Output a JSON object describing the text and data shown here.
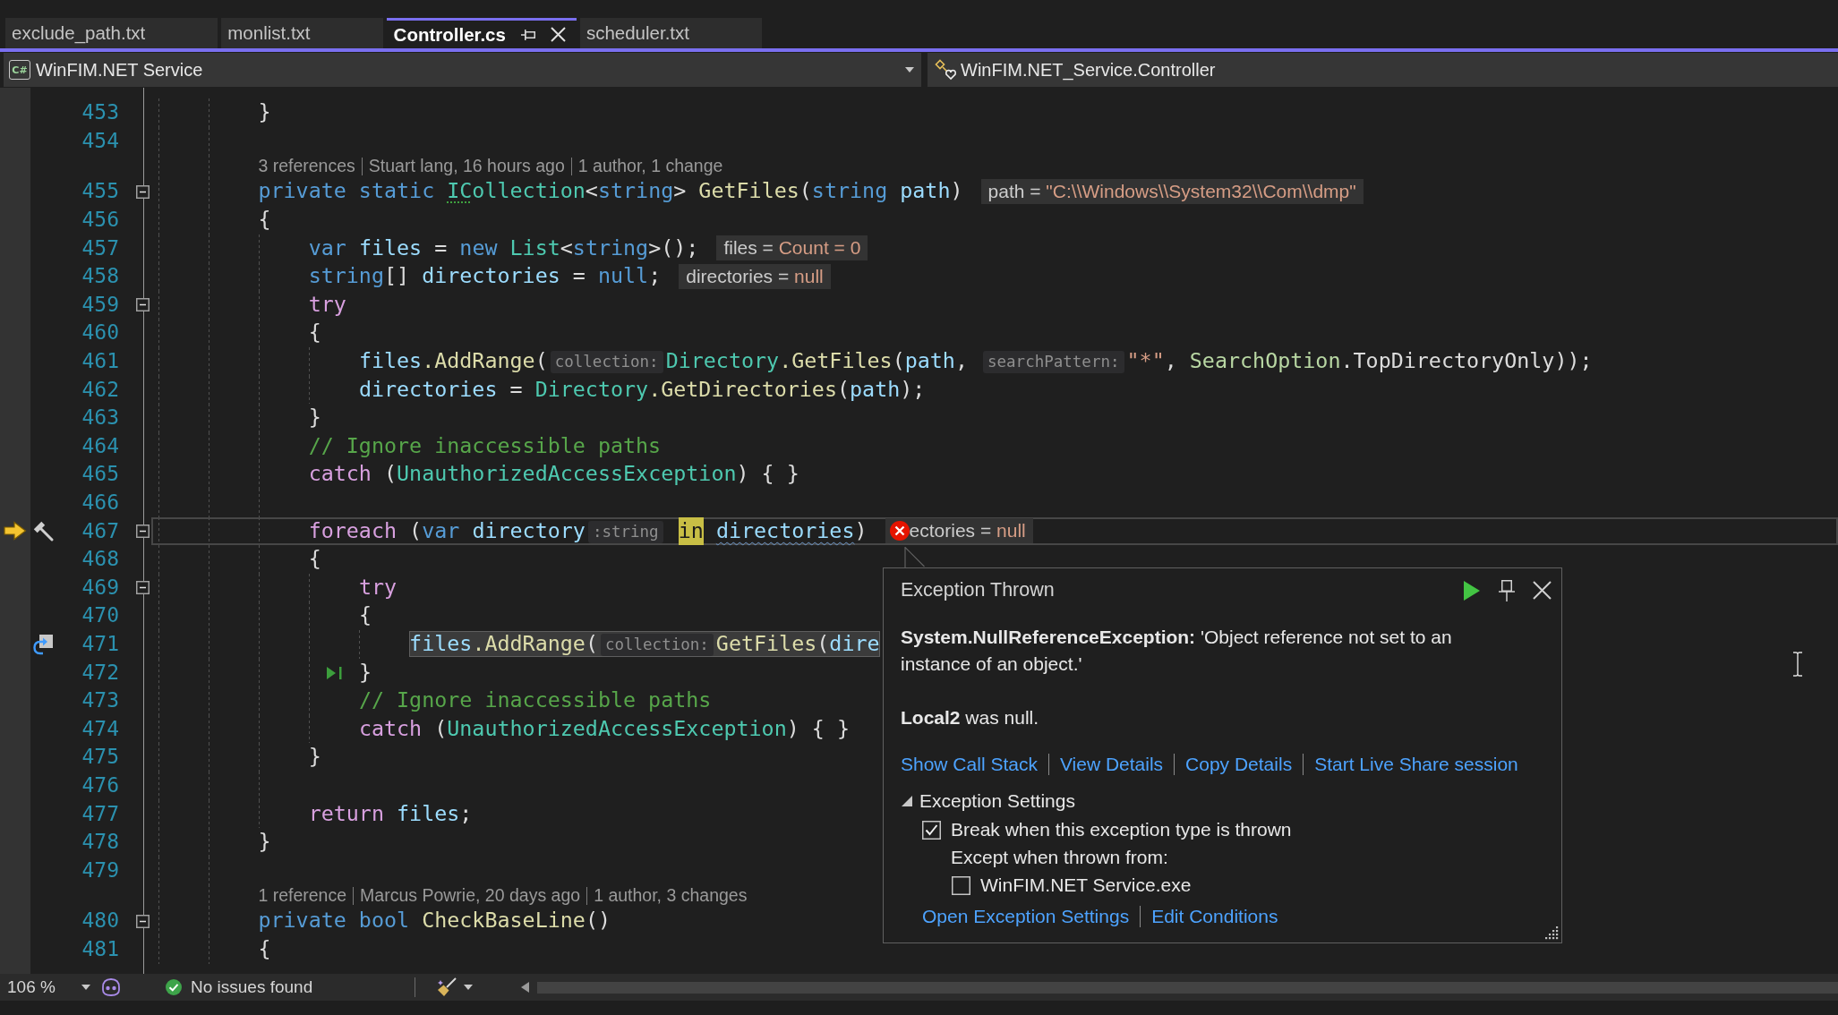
{
  "tabs": [
    {
      "label": "exclude_path.txt",
      "selected": false
    },
    {
      "label": "monlist.txt",
      "selected": false
    },
    {
      "label": "Controller.cs",
      "selected": true
    },
    {
      "label": "scheduler.txt",
      "selected": false
    }
  ],
  "navigation_bar": {
    "project": {
      "badge": "C#",
      "label": "WinFIM.NET Service"
    },
    "type": {
      "label": "WinFIM.NET_Service.Controller"
    }
  },
  "editor": {
    "lines": [
      {
        "kind": "code",
        "number": "453",
        "tokens": [
          {
            "kind": "plain",
            "text": "        }"
          }
        ]
      },
      {
        "kind": "code",
        "number": "454"
      },
      {
        "kind": "codelens",
        "items": [
          "3 references",
          "Stuart lang, 16 hours ago",
          "1 author, 1 change"
        ]
      },
      {
        "kind": "code",
        "number": "455",
        "expanded": true,
        "tokens": [
          {
            "kind": "keyword",
            "text": "        private static "
          },
          {
            "kind": "type",
            "text": "IC",
            "suggestion": true
          },
          {
            "kind": "type",
            "text": "ollection"
          },
          {
            "kind": "plain",
            "text": "<"
          },
          {
            "kind": "keyword",
            "text": "string"
          },
          {
            "kind": "plain",
            "text": "> "
          },
          {
            "kind": "method",
            "text": "GetFiles"
          },
          {
            "kind": "plain",
            "text": "("
          },
          {
            "kind": "keyword",
            "text": "string "
          },
          {
            "kind": "local",
            "text": "path"
          },
          {
            "kind": "plain",
            "text": ")"
          }
        ],
        "datatip": {
          "label": "path =",
          "value": "\"C:\\\\Windows\\\\System32\\\\Com\\\\dmp\""
        }
      },
      {
        "kind": "code",
        "number": "456",
        "tokens": [
          {
            "kind": "plain",
            "text": "        {"
          }
        ]
      },
      {
        "kind": "code",
        "number": "457",
        "tokens": [
          {
            "kind": "keyword",
            "text": "            var "
          },
          {
            "kind": "local",
            "text": "files"
          },
          {
            "kind": "plain",
            "text": " = "
          },
          {
            "kind": "keyword",
            "text": "new "
          },
          {
            "kind": "type",
            "text": "List"
          },
          {
            "kind": "plain",
            "text": "<"
          },
          {
            "kind": "keyword",
            "text": "string"
          },
          {
            "kind": "plain",
            "text": ">();"
          }
        ],
        "datatip": {
          "label": "files =",
          "value": "Count = 0"
        }
      },
      {
        "kind": "code",
        "number": "458",
        "tokens": [
          {
            "kind": "keyword",
            "text": "            string"
          },
          {
            "kind": "plain",
            "text": "[] "
          },
          {
            "kind": "local",
            "text": "directories"
          },
          {
            "kind": "plain",
            "text": " = "
          },
          {
            "kind": "keyword",
            "text": "null"
          },
          {
            "kind": "plain",
            "text": ";"
          }
        ],
        "datatip": {
          "label": "directories =",
          "value": "null"
        }
      },
      {
        "kind": "code",
        "number": "459",
        "expanded": true,
        "tokens": [
          {
            "kind": "control",
            "text": "            try"
          }
        ]
      },
      {
        "kind": "code",
        "number": "460",
        "tokens": [
          {
            "kind": "plain",
            "text": "            {"
          }
        ]
      },
      {
        "kind": "code",
        "number": "461",
        "tokens": [
          {
            "kind": "local",
            "text": "                files"
          },
          {
            "kind": "method",
            "text": ".AddRange"
          },
          {
            "kind": "plain",
            "text": "("
          },
          {
            "kind": "hint",
            "text": "collection:"
          },
          {
            "kind": "type",
            "text": "Directory"
          },
          {
            "kind": "method",
            "text": ".GetFiles"
          },
          {
            "kind": "plain",
            "text": "("
          },
          {
            "kind": "local",
            "text": "path"
          },
          {
            "kind": "plain",
            "text": ", "
          },
          {
            "kind": "hint",
            "text": "searchPattern:"
          },
          {
            "kind": "string",
            "text": "\"*\""
          },
          {
            "kind": "plain",
            "text": ", "
          },
          {
            "kind": "enum",
            "text": "SearchOption"
          },
          {
            "kind": "plain",
            "text": ".TopDirectoryOnly));"
          }
        ]
      },
      {
        "kind": "code",
        "number": "462",
        "tokens": [
          {
            "kind": "local",
            "text": "                directories"
          },
          {
            "kind": "plain",
            "text": " = "
          },
          {
            "kind": "type",
            "text": "Directory"
          },
          {
            "kind": "method",
            "text": ".GetDirectories"
          },
          {
            "kind": "plain",
            "text": "("
          },
          {
            "kind": "local",
            "text": "path"
          },
          {
            "kind": "plain",
            "text": ");"
          }
        ]
      },
      {
        "kind": "code",
        "number": "463",
        "tokens": [
          {
            "kind": "plain",
            "text": "            }"
          }
        ]
      },
      {
        "kind": "code",
        "number": "464",
        "tokens": [
          {
            "kind": "comment",
            "text": "            // Ignore inaccessible paths"
          }
        ]
      },
      {
        "kind": "code",
        "number": "465",
        "tokens": [
          {
            "kind": "control",
            "text": "            catch "
          },
          {
            "kind": "plain",
            "text": "("
          },
          {
            "kind": "type",
            "text": "UnauthorizedAccessException"
          },
          {
            "kind": "plain",
            "text": ") { }"
          }
        ]
      },
      {
        "kind": "code",
        "number": "466"
      },
      {
        "kind": "code",
        "number": "467",
        "expanded": true,
        "current": true,
        "tokens": [
          {
            "kind": "control",
            "text": "            foreach "
          },
          {
            "kind": "plain",
            "text": "("
          },
          {
            "kind": "keyword",
            "text": "var "
          },
          {
            "kind": "local",
            "text": "directory"
          },
          {
            "kind": "hint",
            "text": ":string"
          },
          {
            "kind": "statement",
            "tokens": [
              {
                "kind": "control",
                "text": " in"
              }
            ]
          },
          {
            "kind": "local",
            "text": " directories",
            "warning": true
          },
          {
            "kind": "plain",
            "text": ")"
          }
        ],
        "datatip": {
          "error": true,
          "label": "ectories =",
          "value": "null"
        }
      },
      {
        "kind": "code",
        "number": "468",
        "tokens": [
          {
            "kind": "plain",
            "text": "            {"
          }
        ]
      },
      {
        "kind": "code",
        "number": "469",
        "expanded": true,
        "tokens": [
          {
            "kind": "control",
            "text": "                try"
          }
        ]
      },
      {
        "kind": "code",
        "number": "470",
        "tokens": [
          {
            "kind": "plain",
            "text": "                {"
          }
        ]
      },
      {
        "kind": "code",
        "number": "471",
        "call_return": true,
        "tokens": [
          {
            "kind": "statement",
            "tokens": [
              {
                "kind": "local",
                "text": "                    files"
              },
              {
                "kind": "method",
                "text": ".AddRange"
              },
              {
                "kind": "plain",
                "text": "("
              },
              {
                "kind": "hint",
                "text": "collection:"
              },
              {
                "kind": "method",
                "text": "GetFiles"
              },
              {
                "kind": "plain",
                "text": "("
              },
              {
                "kind": "local",
                "text": "dire"
              }
            ]
          }
        ]
      },
      {
        "kind": "code",
        "number": "472",
        "run_to_click": true,
        "tokens": [
          {
            "kind": "plain",
            "text": "                }"
          }
        ]
      },
      {
        "kind": "code",
        "number": "473",
        "tokens": [
          {
            "kind": "comment",
            "text": "                // Ignore inaccessible paths"
          }
        ]
      },
      {
        "kind": "code",
        "number": "474",
        "tokens": [
          {
            "kind": "control",
            "text": "                catch "
          },
          {
            "kind": "plain",
            "text": "("
          },
          {
            "kind": "type",
            "text": "UnauthorizedAccessException"
          },
          {
            "kind": "plain",
            "text": ") { }"
          }
        ]
      },
      {
        "kind": "code",
        "number": "475",
        "tokens": [
          {
            "kind": "plain",
            "text": "            }"
          }
        ]
      },
      {
        "kind": "code",
        "number": "476"
      },
      {
        "kind": "code",
        "number": "477",
        "tokens": [
          {
            "kind": "control",
            "text": "            return "
          },
          {
            "kind": "local",
            "text": "files"
          },
          {
            "kind": "plain",
            "text": ";"
          }
        ]
      },
      {
        "kind": "code",
        "number": "478",
        "tokens": [
          {
            "kind": "plain",
            "text": "        }"
          }
        ]
      },
      {
        "kind": "code",
        "number": "479"
      },
      {
        "kind": "codelens",
        "items": [
          "1 reference",
          "Marcus Powrie, 20 days ago",
          "1 author, 3 changes"
        ]
      },
      {
        "kind": "code",
        "number": "480",
        "expanded": true,
        "tokens": [
          {
            "kind": "keyword",
            "text": "        private bool "
          },
          {
            "kind": "method",
            "text": "CheckBaseLine"
          },
          {
            "kind": "plain",
            "text": "()"
          }
        ]
      },
      {
        "kind": "code",
        "number": "481",
        "tokens": [
          {
            "kind": "plain",
            "text": "        {"
          }
        ]
      }
    ]
  },
  "exception_popup": {
    "title": "Exception Thrown",
    "message": "**System.NullReferenceException:** 'Object reference not set to an instance of an object.'",
    "detail": "**Local2** was null.",
    "links": [
      "Show Call Stack",
      "View Details",
      "Copy Details",
      "Start Live Share session"
    ],
    "settings": {
      "label": "Exception Settings",
      "expanded": true,
      "options": [
        {
          "kind": "checkbox",
          "label": "Break when this exception type is thrown",
          "checked": true
        },
        {
          "kind": "text",
          "label": "Except when thrown from:",
          "children": [
            {
              "kind": "checkbox",
              "label": "WinFIM.NET Service.exe",
              "checked": false
            }
          ]
        }
      ],
      "links": [
        "Open Exception Settings",
        "Edit Conditions"
      ]
    }
  },
  "status_bar": {
    "zoom": "106 %",
    "issues": "No issues found"
  }
}
